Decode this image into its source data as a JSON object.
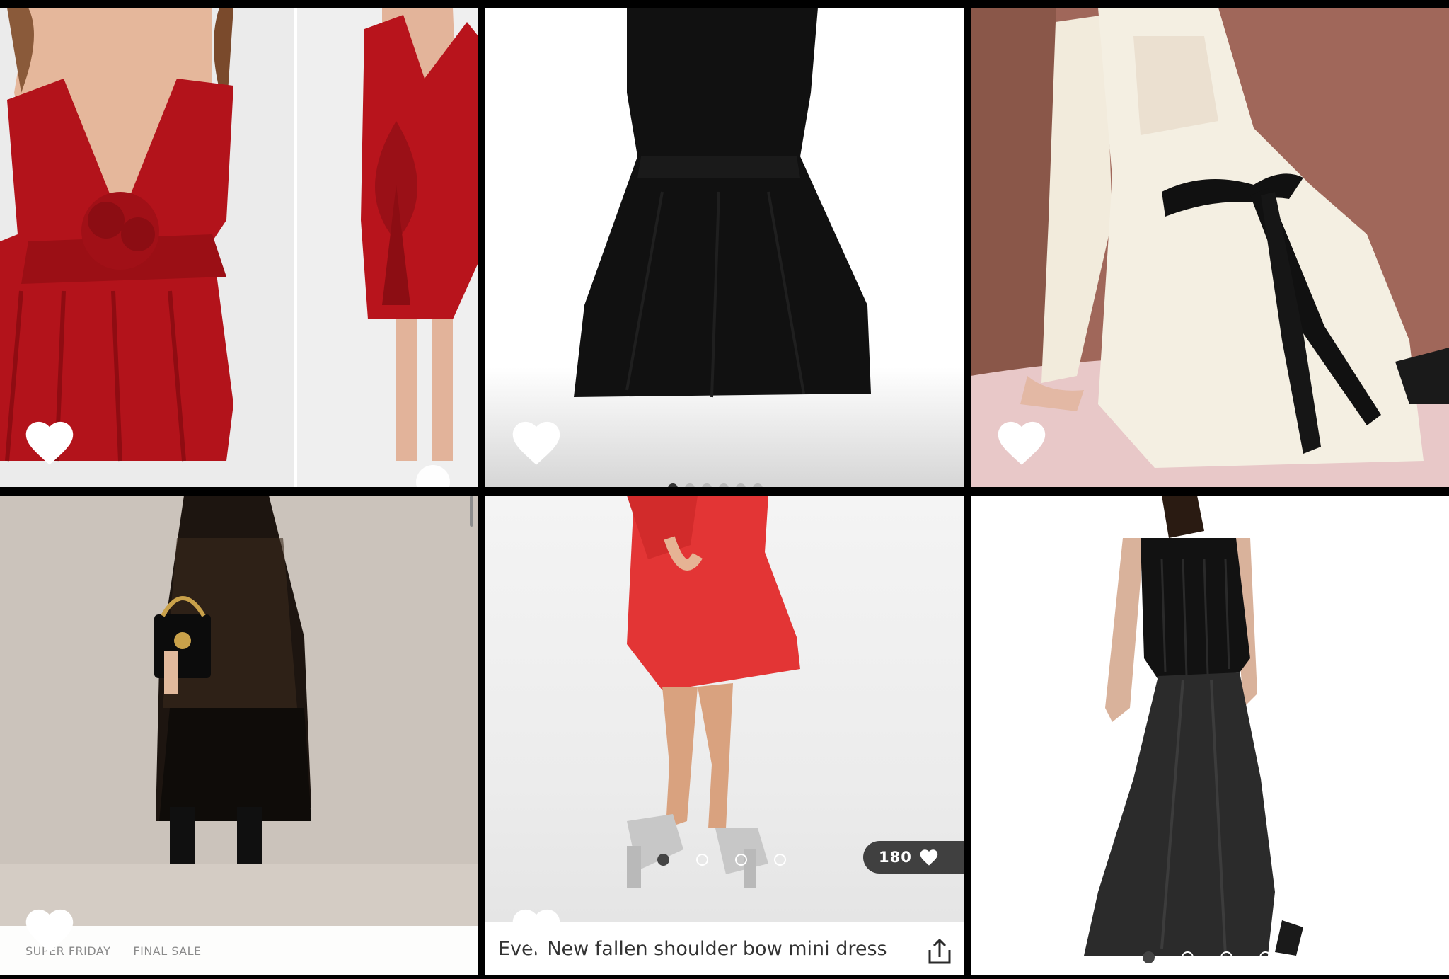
{
  "colors": {
    "background": "#000000",
    "heart": "#ffffff",
    "pill_bg": "#2a2a2a",
    "dot_active": "#444444",
    "caption_text": "#333333",
    "badge_text": "#8a8a8a"
  },
  "products": [
    {
      "id": "red-bow-dress",
      "heart_icon": "heart-icon",
      "saved": false
    },
    {
      "id": "black-velvet-dress",
      "heart_icon": "heart-icon",
      "saved": false
    },
    {
      "id": "white-ribbon-dress",
      "heart_icon": "heart-icon",
      "saved": false
    },
    {
      "id": "black-lace-maxi",
      "heart_icon": "heart-icon",
      "saved": false,
      "badges": [
        "SUPER FRIDAY",
        "FINAL SALE"
      ]
    },
    {
      "id": "red-bow-mini",
      "heart_icon": "heart-icon",
      "saved": false,
      "like_count": "180",
      "title": "Ever New fallen shoulder bow mini dress in",
      "share_icon": "share-icon",
      "carousel": {
        "count": 4,
        "active": 1
      }
    },
    {
      "id": "black-velvet-slip",
      "heart_icon": "heart-icon",
      "saved": false,
      "carousel": {
        "count": 4,
        "active": 1
      }
    }
  ]
}
